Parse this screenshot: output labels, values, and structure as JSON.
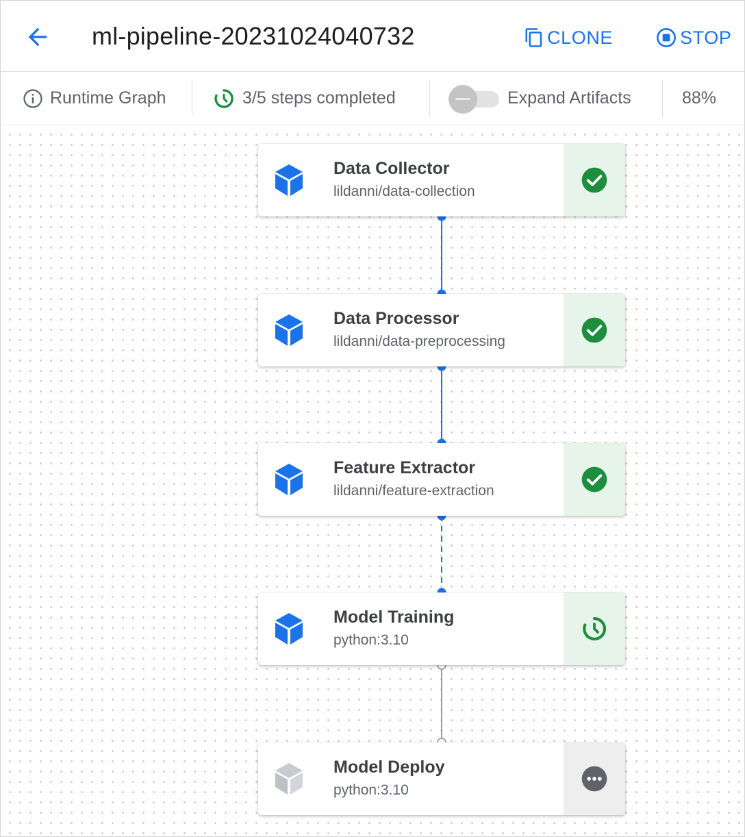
{
  "header": {
    "title": "ml-pipeline-20231024040732",
    "clone_label": "CLONE",
    "stop_label": "STOP",
    "back_icon": "arrow-back-icon",
    "clone_icon": "copy-icon",
    "stop_icon": "stop-circle-icon"
  },
  "toolbar": {
    "runtime_graph_label": "Runtime Graph",
    "steps_status": "3/5 steps completed",
    "expand_artifacts_label": "Expand Artifacts",
    "expand_artifacts_enabled": false,
    "zoom": "88%"
  },
  "colors": {
    "accent": "#1a73e8",
    "success": "#1e8e3e",
    "success_bg": "#e6f4ea",
    "pending_bg": "#eeeeee",
    "pending_icon": "#5f6368",
    "cube_active": "#1a73e8",
    "cube_inactive": "#bdc1c6",
    "edge_done": "#1a73e8",
    "edge_pending": "#9e9e9e"
  },
  "nodes": [
    {
      "name": "Data Collector",
      "image": "lildanni/data-collection",
      "status": "succeeded",
      "status_icon": "check-circle-icon"
    },
    {
      "name": "Data Processor",
      "image": "lildanni/data-preprocessing",
      "status": "succeeded",
      "status_icon": "check-circle-icon"
    },
    {
      "name": "Feature Extractor",
      "image": "lildanni/feature-extraction",
      "status": "succeeded",
      "status_icon": "check-circle-icon"
    },
    {
      "name": "Model Training",
      "image": "python:3.10",
      "status": "running",
      "status_icon": "refresh-running-icon"
    },
    {
      "name": "Model Deploy",
      "image": "python:3.10",
      "status": "pending",
      "status_icon": "more-horizontal-icon"
    }
  ]
}
